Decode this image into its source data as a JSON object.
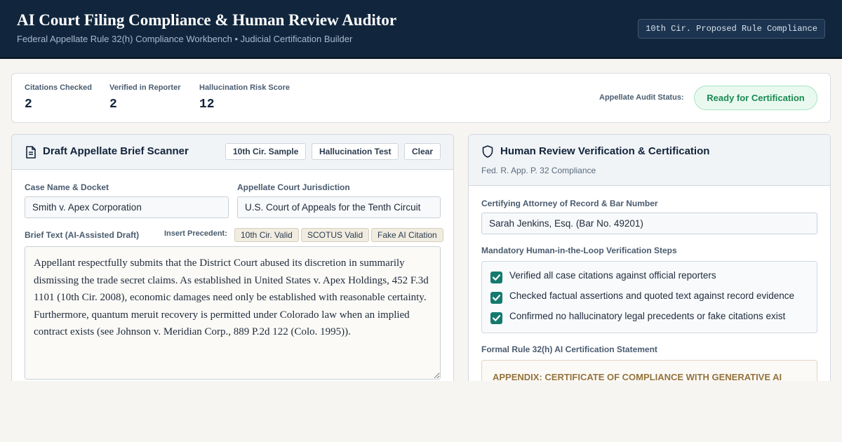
{
  "header": {
    "title": "AI Court Filing Compliance & Human Review Auditor",
    "subtitle": "Federal Appellate Rule 32(h) Compliance Workbench • Judicial Certification Builder",
    "rule_badge": "10th Cir. Proposed Rule Compliance"
  },
  "stats": {
    "citations_checked": {
      "label": "Citations Checked",
      "value": "2"
    },
    "verified_in_reporter": {
      "label": "Verified in Reporter",
      "value": "2"
    },
    "hallucination_risk": {
      "label": "Hallucination Risk Score",
      "value": "12"
    },
    "audit_status_label": "Appellate Audit Status:",
    "audit_status": "Ready for Certification"
  },
  "scanner": {
    "title": "Draft Appellate Brief Scanner",
    "title_icon": "document-icon",
    "buttons": {
      "sample": "10th Cir. Sample",
      "hallucination_test": "Hallucination Test",
      "clear": "Clear"
    },
    "case_label": "Case Name & Docket",
    "case_value": "Smith v. Apex Corporation",
    "jurisdiction_label": "Appellate Court Jurisdiction",
    "jurisdiction_value": "U.S. Court of Appeals for the Tenth Circuit",
    "brief_label": "Brief Text (AI-Assisted Draft)",
    "insert_label": "Insert Precedent:",
    "precedents": [
      "10th Cir. Valid",
      "SCOTUS Valid",
      "Fake AI Citation"
    ],
    "brief_text": "Appellant respectfully submits that the District Court abused its discretion in summarily dismissing the trade secret claims. As established in United States v. Apex Holdings, 452 F.3d 1101 (10th Cir. 2008), economic damages need only be established with reasonable certainty. Furthermore, quantum meruit recovery is permitted under Colorado law when an implied contract exists (see Johnson v. Meridian Corp., 889 P.2d 122 (Colo. 1995))."
  },
  "review": {
    "title": "Human Review Verification & Certification",
    "title_icon": "shield-icon",
    "subtitle": "Fed. R. App. P. 32 Compliance",
    "attorney_label": "Certifying Attorney of Record & Bar Number",
    "attorney_value": "Sarah Jenkins, Esq. (Bar No. 49201)",
    "steps_label": "Mandatory Human-in-the-Loop Verification Steps",
    "steps": [
      {
        "label": "Verified all case citations against official reporters",
        "checked": true
      },
      {
        "label": "Checked factual assertions and quoted text against record evidence",
        "checked": true
      },
      {
        "label": "Confirmed no hallucinatory legal precedents or fake citations exist",
        "checked": true
      }
    ],
    "cert_label": "Formal Rule 32(h) AI Certification Statement",
    "cert_heading": "APPENDIX: CERTIFICATE OF COMPLIANCE WITH GENERATIVE AI"
  },
  "colors": {
    "header_bg": "#11263d",
    "accent_green": "#1a8a52",
    "checkbox": "#157a6e"
  }
}
